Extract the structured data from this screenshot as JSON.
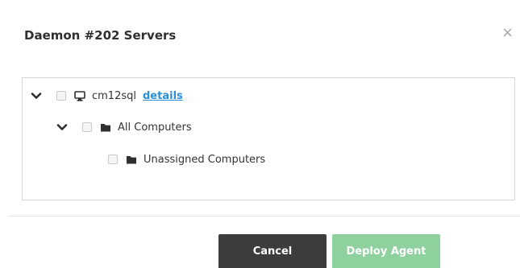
{
  "dialog": {
    "title": "Daemon #202 Servers",
    "close_glyph": "×"
  },
  "tree": {
    "root": {
      "label": "cm12sql",
      "link_label": "details",
      "icon": "desktop-icon",
      "expanded": true,
      "checked": false
    },
    "group": {
      "label": "All Computers",
      "icon": "folder-icon",
      "expanded": true,
      "checked": false
    },
    "leaf": {
      "label": "Unassigned Computers",
      "icon": "folder-icon",
      "checked": false
    }
  },
  "footer": {
    "cancel_label": "Cancel",
    "deploy_label": "Deploy Agent"
  },
  "colors": {
    "cancel_bg": "#3c3c3c",
    "deploy_bg": "#8fd19e",
    "link": "#2a8fd8"
  }
}
